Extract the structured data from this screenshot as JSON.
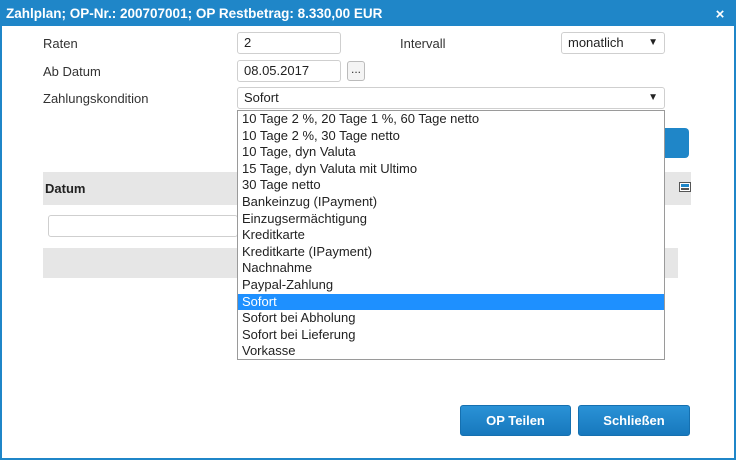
{
  "window": {
    "title": "Zahlplan; OP-Nr.: 200707001; OP Restbetrag: 8.330,00 EUR",
    "close_symbol": "×"
  },
  "form": {
    "raten_label": "Raten",
    "raten_value": "2",
    "intervall_label": "Intervall",
    "intervall_value": "monatlich",
    "ab_datum_label": "Ab Datum",
    "ab_datum_value": "08.05.2017",
    "date_picker_label": "...",
    "zahlungskondition_label": "Zahlungskondition",
    "zahlungskondition_value": "Sofort",
    "dropdown_arrow": "▼"
  },
  "dropdown": {
    "options": [
      "10 Tage 2 %, 20 Tage 1 %, 60 Tage netto",
      "10 Tage 2 %, 30 Tage netto",
      "10 Tage, dyn Valuta",
      "15 Tage, dyn Valuta mit Ultimo",
      "30 Tage netto",
      "Bankeinzug (IPayment)",
      "Einzugsermächtigung",
      "Kreditkarte",
      "Kreditkarte (IPayment)",
      "Nachnahme",
      "Paypal-Zahlung",
      "Sofort",
      "Sofort bei Abholung",
      "Sofort bei Lieferung",
      "Vorkasse"
    ],
    "selected_index": 11
  },
  "grid": {
    "column_datum": "Datum"
  },
  "buttons": {
    "op_teilen": "OP Teilen",
    "schliessen": "Schließen"
  },
  "colors": {
    "accent": "#1f86c8",
    "selection": "#1e90ff"
  }
}
